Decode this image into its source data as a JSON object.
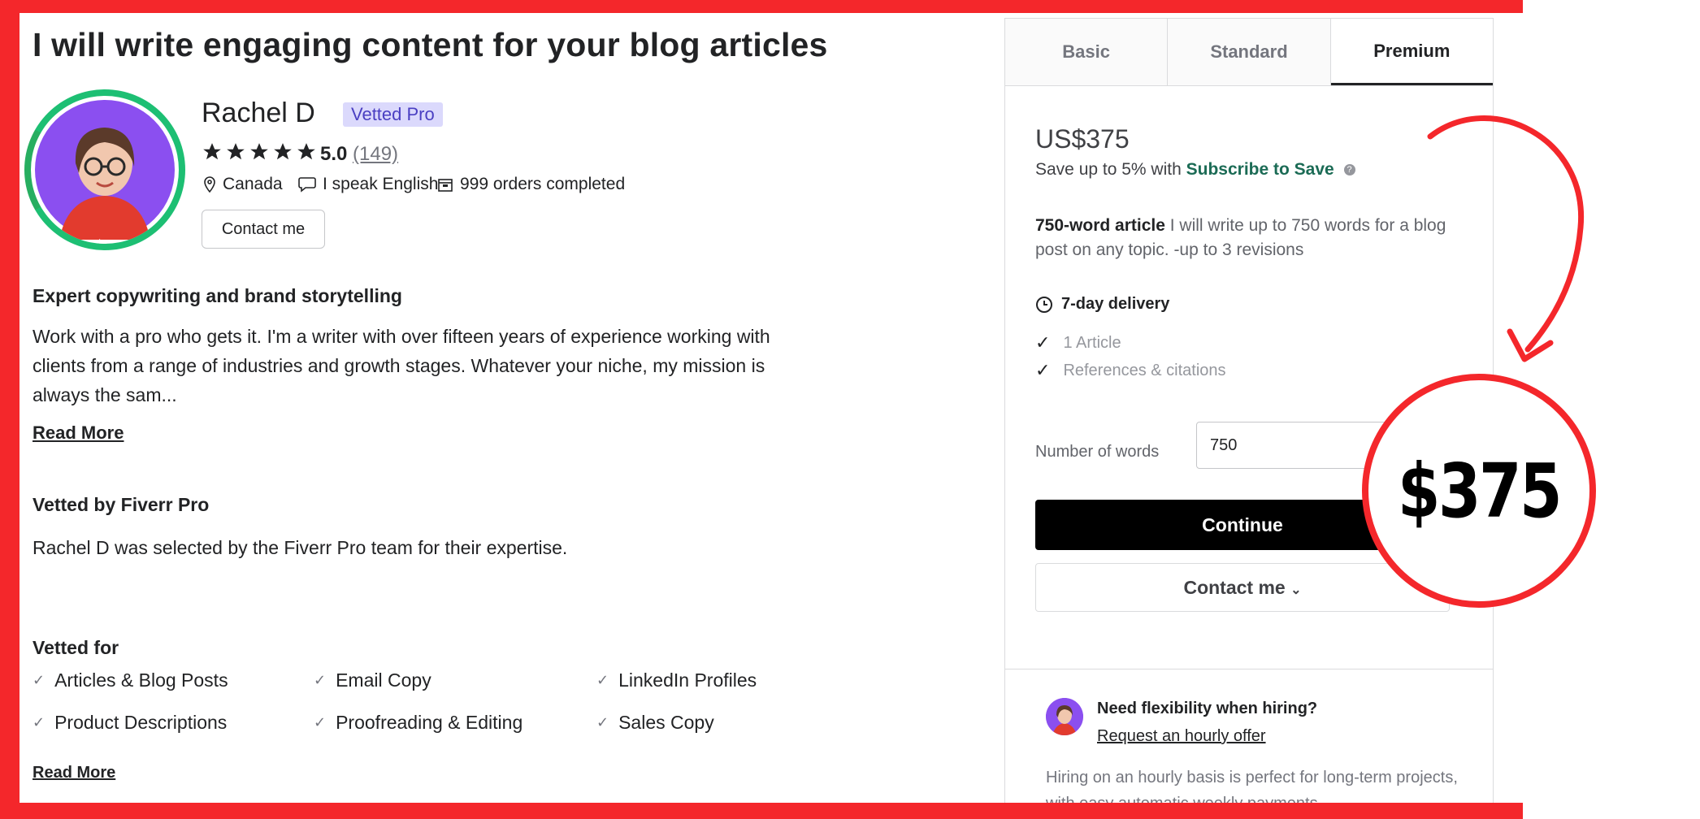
{
  "gig": {
    "title": "I will write engaging content for your blog articles"
  },
  "seller": {
    "name": "Rachel D",
    "badge": "Vetted Pro",
    "rating": "5.0",
    "rating_count": "(149)",
    "country": "Canada",
    "language": "I speak English",
    "orders": "999 orders completed",
    "contact_label": "Contact me"
  },
  "about": {
    "heading": "Expert copywriting and brand storytelling",
    "lines": [
      "Work with a pro who gets it. I'm a writer with over fifteen years of experience working with",
      "clients from a range of industries and growth stages. Whatever your niche, my mission is",
      "always the sam..."
    ],
    "read_more": "Read More"
  },
  "vetted": {
    "heading": "Vetted by Fiverr Pro",
    "text": "Rachel D was selected by the Fiverr Pro team for their expertise."
  },
  "vetted_for": {
    "heading": "Vetted for",
    "items": [
      "Articles & Blog Posts",
      "Email Copy",
      "LinkedIn Profiles",
      "Product Descriptions",
      "Proofreading & Editing",
      "Sales Copy"
    ],
    "read_more": "Read More"
  },
  "package": {
    "tabs": [
      "Basic",
      "Standard",
      "Premium"
    ],
    "active_tab": "Premium",
    "price": "US$375",
    "save_prefix": "Save up to 5% with",
    "save_link": "Subscribe to Save",
    "title": "750-word article",
    "description": "I will write up to 750 words for a blog post on any topic. -up to 3 revisions",
    "delivery": "7-day delivery",
    "features": [
      "1 Article",
      "References & citations"
    ],
    "words_label": "Number of words",
    "words_value": "750",
    "continue_label": "Continue",
    "contact_label": "Contact me"
  },
  "hourly": {
    "title": "Need flexibility when hiring?",
    "link": "Request an hourly offer",
    "text": "Hiring on an hourly basis is perfect for long-term projects, with easy automatic weekly payments."
  },
  "annotation": {
    "price_callout": "$375"
  },
  "colors": {
    "frame": "#f4272b",
    "brand_green": "#1dbf73",
    "save_link": "#1b6b55",
    "badge_bg": "#dbd9fc"
  }
}
